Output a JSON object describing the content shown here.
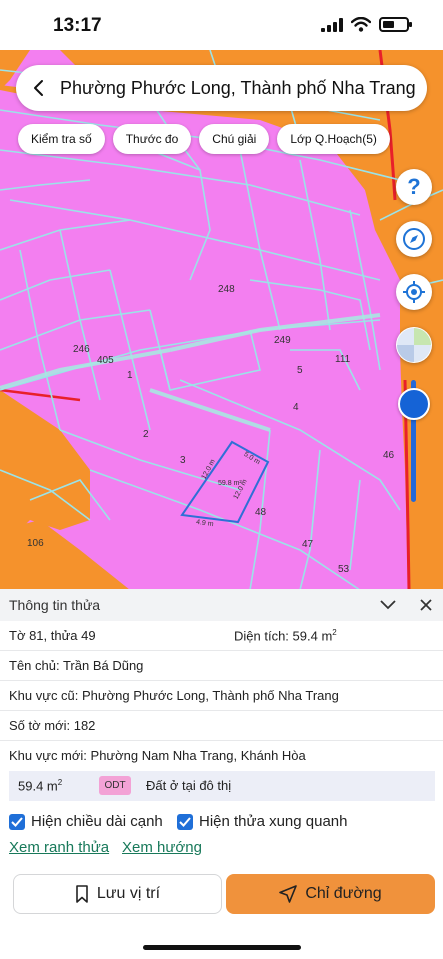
{
  "status_bar": {
    "time": "13:17",
    "battery_level": 0.45
  },
  "search": {
    "title": "Phường Phước Long, Thành phố Nha Trang"
  },
  "chips": [
    "Kiểm tra số",
    "Thước đo",
    "Chú giải",
    "Lớp Q.Hoạch(5)"
  ],
  "map_controls": {
    "help_label": "?",
    "icons": [
      "help-icon",
      "compass-icon",
      "locate-icon",
      "layer-opacity-icon"
    ],
    "zoom_level": 0.2
  },
  "map": {
    "colors": {
      "residential": "#f37ff0",
      "other": "#f5922c",
      "parcel_line": "#9be3e8",
      "road": "#a9e7e2",
      "selected": "#2f6fd6",
      "boundary": "#e8202a"
    },
    "plot_numbers": [
      "248",
      "249",
      "111",
      "246",
      "405",
      "1",
      "5",
      "4",
      "2",
      "3",
      "46",
      "48",
      "47",
      "106",
      "53"
    ],
    "selected_parcel": {
      "area": "59.8 m²",
      "edges": [
        "12.0 m",
        "5.0 m",
        "12.0 m",
        "4.9 m"
      ]
    }
  },
  "panel": {
    "title": "Thông tin thửa",
    "sheet_parcel": "Tờ 81, thửa 49",
    "area_label": "Diện tích: 59.4 m",
    "area_sup": "2",
    "owner": "Tên chủ: Trần Bá Dũng",
    "old_area": "Khu vực cũ: Phường Phước Long, Thành phố Nha Trang",
    "new_sheet": "Số tờ mới: 182",
    "new_area": "Khu vực mới: Phường Nam Nha Trang, Khánh Hòa",
    "land_use": {
      "area": "59.4 m",
      "area_sup": "2",
      "code": "ODT",
      "description": "Đất ở tại đô thị"
    },
    "checkboxes": [
      {
        "label": "Hiện chiều dài cạnh",
        "checked": true
      },
      {
        "label": "Hiện thửa xung quanh",
        "checked": true
      }
    ],
    "links": [
      "Xem ranh thửa",
      "Xem hướng"
    ],
    "buttons": {
      "save": "Lưu vị trí",
      "directions": "Chỉ đường"
    }
  }
}
